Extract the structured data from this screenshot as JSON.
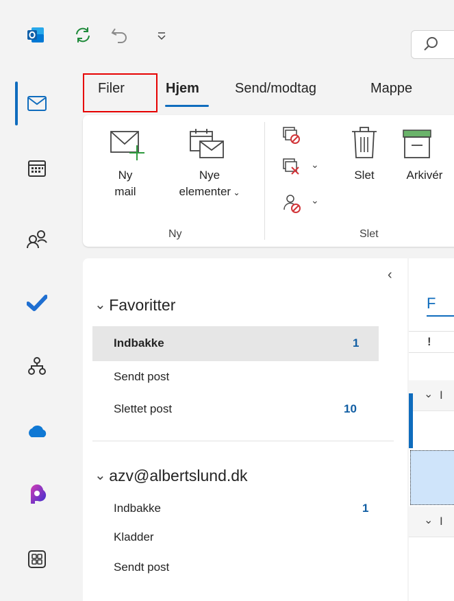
{
  "quick_access": {
    "app_icon": "outlook-icon",
    "sync_icon": "sync-icon",
    "undo_icon": "undo-icon",
    "customize_icon": "customize-toolbar-icon",
    "search_icon": "search-icon"
  },
  "rail": {
    "items": [
      "mail-icon",
      "calendar-icon",
      "people-icon",
      "todo-icon",
      "org-explorer-icon",
      "onedrive-icon",
      "copilot-icon",
      "more-apps-icon"
    ]
  },
  "tabs": [
    {
      "label": "Filer"
    },
    {
      "label": "Hjem"
    },
    {
      "label": "Send/modtag"
    },
    {
      "label": "Mappe"
    }
  ],
  "ribbon": {
    "new_mail_line1": "Ny",
    "new_mail_line2": "mail",
    "new_items_line1": "Nye",
    "new_items_line2": "elementer",
    "group_new": "Ny",
    "delete_label": "Slet",
    "archive_label": "Arkivér",
    "group_delete": "Slet"
  },
  "folders": {
    "collapse_glyph": "‹",
    "favorites_title": "Favoritter",
    "favorites": [
      {
        "label": "Indbakke",
        "count": "1"
      },
      {
        "label": "Sendt post",
        "count": ""
      },
      {
        "label": "Slettet post",
        "count": "10"
      }
    ],
    "account_title": "azv@albertslund.dk",
    "account_items": [
      {
        "label": "Indbakke",
        "count": "1"
      },
      {
        "label": "Kladder",
        "count": ""
      },
      {
        "label": "Sendt post",
        "count": ""
      }
    ]
  },
  "message_list": {
    "tab_partial": "F",
    "importance_header": "!",
    "group1_partial": "I",
    "group2_partial": "I"
  },
  "colors": {
    "accent": "#0f6cbd",
    "highlight_box": "#e60000",
    "selection": "#cfe4fa"
  }
}
